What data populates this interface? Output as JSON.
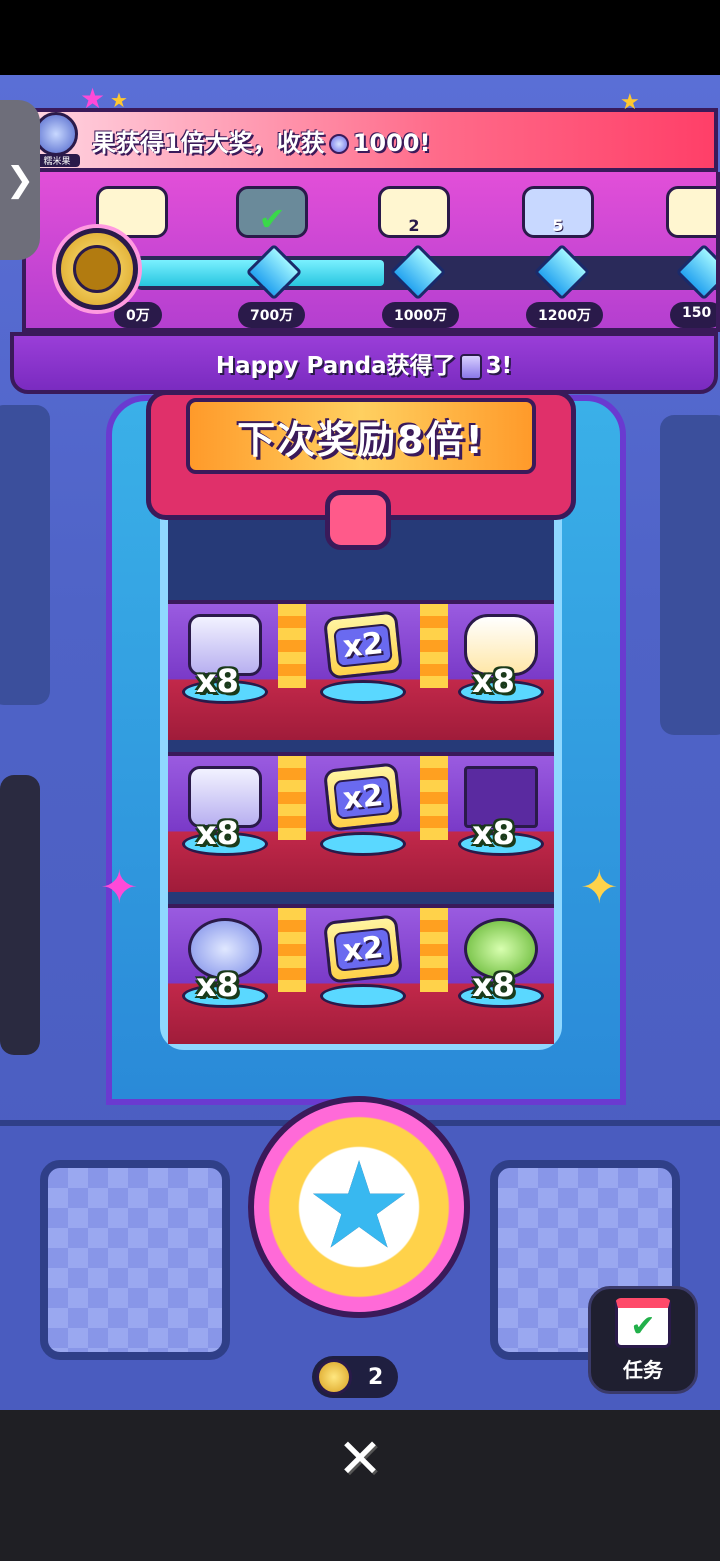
{
  "ticker": {
    "text_prefix": "果获得1倍大奖，收获",
    "text_amount": "1000!",
    "avatar_label": "糯米果",
    "gem_icon": "gem-icon"
  },
  "progress": {
    "milestones": [
      {
        "label": "0万",
        "badge": ""
      },
      {
        "label": "700万",
        "badge": ""
      },
      {
        "label": "1000万",
        "badge": "2"
      },
      {
        "label": "1200万",
        "badge": "5"
      },
      {
        "label": "150",
        "badge": ""
      }
    ],
    "fill_fraction": 0.42
  },
  "announce": {
    "prefix": "Happy Panda获得了",
    "suffix": "3!"
  },
  "banner": {
    "text": "下次奖励8倍!"
  },
  "shelves": [
    {
      "left": "x8",
      "middle": "x2",
      "right": "x8"
    },
    {
      "left": "x8",
      "middle": "x2",
      "right": "x8"
    },
    {
      "left": "x8",
      "middle": "x2",
      "right": "x8"
    }
  ],
  "controls": {
    "coin_count": "2",
    "task_label": "任务",
    "close_glyph": "✕"
  },
  "side_tab_glyph": "❯"
}
